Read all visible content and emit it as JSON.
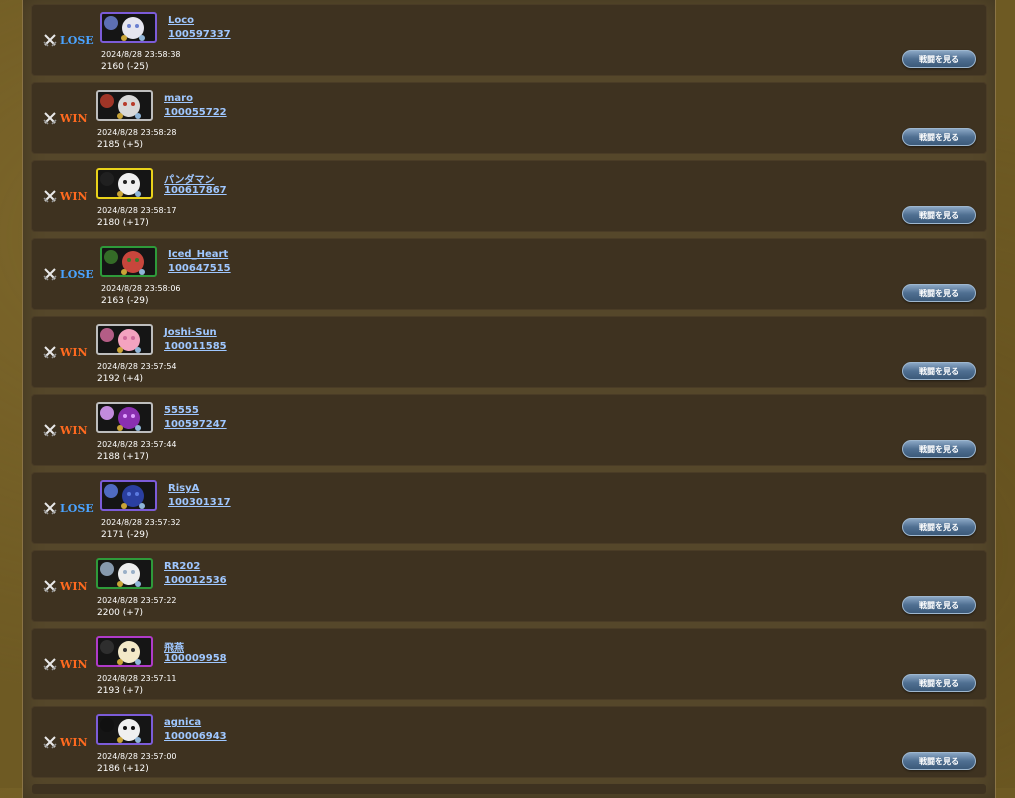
{
  "colors": {
    "win": "#ff6a1f",
    "lose": "#4aa3ff",
    "link": "#9fc7ff",
    "button": "#4f6f91"
  },
  "watch_label": "戦闘を見る",
  "matches": [
    {
      "result": "LOSE",
      "name": "Loco",
      "id": "100597337",
      "time": "2024/8/28 23:58:38",
      "rate": "2160 (-25)",
      "frame": "#7c5cd8",
      "icon": "ghost-character-icon"
    },
    {
      "result": "WIN",
      "name": "maro",
      "id": "100055722",
      "time": "2024/8/28 23:58:28",
      "rate": "2185 (+5)",
      "frame": "#bdbdbd",
      "icon": "warrior-character-icon"
    },
    {
      "result": "WIN",
      "name": "パンダマン",
      "id": "100617867",
      "time": "2024/8/28 23:58:17",
      "rate": "2180 (+17)",
      "frame": "#e9d21a",
      "icon": "panda-character-icon"
    },
    {
      "result": "LOSE",
      "name": "Iced_Heart",
      "id": "100647515",
      "time": "2024/8/28 23:58:06",
      "rate": "2163 (-29)",
      "frame": "#2e9a3a",
      "icon": "flower-character-icon"
    },
    {
      "result": "WIN",
      "name": "Joshi-Sun",
      "id": "100011585",
      "time": "2024/8/28 23:57:54",
      "rate": "2192 (+4)",
      "frame": "#bdbdbd",
      "icon": "pink-hair-character-icon"
    },
    {
      "result": "WIN",
      "name": "55555",
      "id": "100597247",
      "time": "2024/8/28 23:57:44",
      "rate": "2188 (+17)",
      "frame": "#bdbdbd",
      "icon": "purple-orb-character-icon"
    },
    {
      "result": "LOSE",
      "name": "RisyA",
      "id": "100301317",
      "time": "2024/8/28 23:57:32",
      "rate": "2171 (-29)",
      "frame": "#7c5cd8",
      "icon": "blue-beast-character-icon"
    },
    {
      "result": "WIN",
      "name": "RR202",
      "id": "100012536",
      "time": "2024/8/28 23:57:22",
      "rate": "2200 (+7)",
      "frame": "#2e9a3a",
      "icon": "white-robot-character-icon"
    },
    {
      "result": "WIN",
      "name": "飛燕",
      "id": "100009958",
      "time": "2024/8/28 23:57:11",
      "rate": "2193 (+7)",
      "frame": "#b03ac8",
      "icon": "mask-character-icon"
    },
    {
      "result": "WIN",
      "name": "agnica",
      "id": "100006943",
      "time": "2024/8/28 23:57:00",
      "rate": "2186 (+12)",
      "frame": "#7c5cd8",
      "icon": "dark-portrait-character-icon"
    }
  ]
}
